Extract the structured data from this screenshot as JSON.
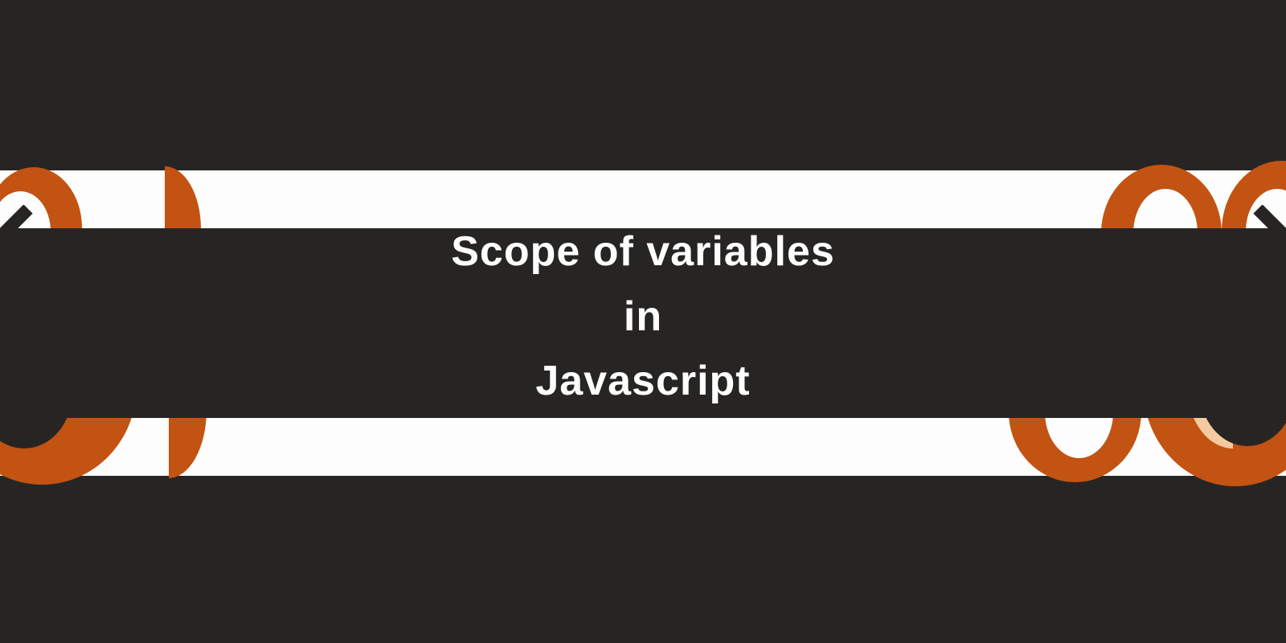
{
  "title": {
    "line1": "Scope of variables",
    "line2": "in",
    "line3": "Javascript"
  },
  "colors": {
    "background": "#272524",
    "accent_orange": "#c35312",
    "accent_light": "#f5caa1",
    "band": "#fdfdfd",
    "text": "#fdfdfd"
  }
}
